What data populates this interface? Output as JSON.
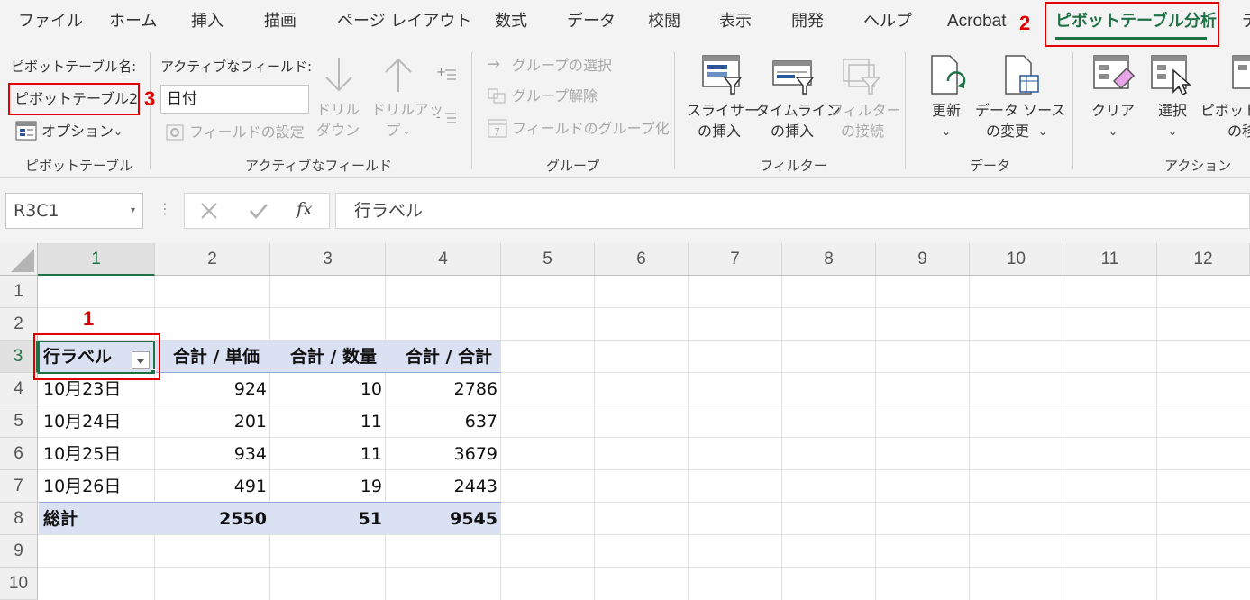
{
  "ribbon_tabs": [
    {
      "label": "ファイル",
      "icon": ""
    },
    {
      "label": "ホーム"
    },
    {
      "label": "挿入"
    },
    {
      "label": "描画"
    },
    {
      "label": "ページ レイアウト"
    },
    {
      "label": "数式"
    },
    {
      "label": "データ"
    },
    {
      "label": "校閲"
    },
    {
      "label": "表示"
    },
    {
      "label": "開発"
    },
    {
      "label": "ヘルプ"
    },
    {
      "label": "Acrobat"
    },
    {
      "label": "ピボットテーブル分析"
    },
    {
      "label": "デ"
    }
  ],
  "steps": {
    "one": "1",
    "two": "2",
    "three": "3"
  },
  "pivottable_group": {
    "name_label": "ピボットテーブル名:",
    "name_value": "ピボットテーブル2",
    "options_label": "オプション",
    "group_label": "ピボットテーブル"
  },
  "active_field_group": {
    "label": "アクティブなフィールド:",
    "value": "日付",
    "field_settings": "フィールドの設定",
    "drill_down": [
      "ドリル",
      "ダウン"
    ],
    "drill_up": [
      "ドリルアッ",
      "プ"
    ],
    "group_label": "アクティブなフィールド"
  },
  "group_group": {
    "group_selection": "グループの選択",
    "ungroup": "グループ解除",
    "group_field": "フィールドのグループ化",
    "group_label": "グループ"
  },
  "filter_group": {
    "slicer": [
      "スライサー",
      "の挿入"
    ],
    "timeline": [
      "タイムライン",
      "の挿入"
    ],
    "filter_connections": [
      "フィルター",
      "の接続"
    ],
    "group_label": "フィルター"
  },
  "data_group": {
    "refresh": "更新",
    "change_source": [
      "データ ソース",
      "の変更"
    ],
    "group_label": "データ"
  },
  "actions_group": {
    "clear": "クリア",
    "select": "選択",
    "move": [
      "ピボットテ",
      "の移"
    ],
    "group_label": "アクション"
  },
  "formula_bar": {
    "cell_ref": "R3C1",
    "formula": "行ラベル",
    "fx": "fx"
  },
  "columns": [
    "1",
    "2",
    "3",
    "4",
    "5",
    "6",
    "7",
    "8",
    "9",
    "10",
    "11",
    "12"
  ],
  "rows": [
    "1",
    "2",
    "3",
    "4",
    "5",
    "6",
    "7",
    "8",
    "9",
    "10"
  ],
  "pivot": {
    "headers": [
      "行ラベル",
      "合計 / 単価",
      "合計 / 数量",
      "合計 / 合計"
    ],
    "data": [
      [
        "10月23日",
        "924",
        "10",
        "2786"
      ],
      [
        "10月24日",
        "201",
        "11",
        "637"
      ],
      [
        "10月25日",
        "934",
        "11",
        "3679"
      ],
      [
        "10月26日",
        "491",
        "19",
        "2443"
      ]
    ],
    "total": [
      "総計",
      "2550",
      "51",
      "9545"
    ]
  },
  "colors": {
    "excel_green": "#1e7145",
    "annotation_red": "#e00000",
    "pivot_band": "#d9e1f2"
  }
}
